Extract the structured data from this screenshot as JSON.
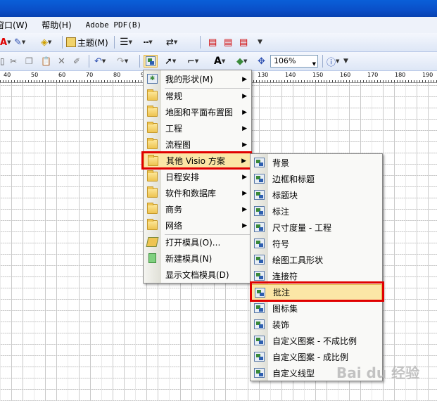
{
  "menubar": {
    "window": "窗口(W)",
    "help": "帮助(H)",
    "adobe": "Adobe PDF(B)"
  },
  "toolbar": {
    "theme_label": "主题(M)",
    "zoom": "106%"
  },
  "ruler": {
    "ticks": [
      "40",
      "50",
      "60",
      "70",
      "80",
      "90",
      "100",
      "110",
      "120",
      "130",
      "140",
      "150",
      "160",
      "170",
      "180",
      "190"
    ]
  },
  "shapes_menu": {
    "items": [
      {
        "label": "我的形状(M)",
        "icon": "special",
        "arrow": true
      },
      {
        "label": "常规",
        "icon": "folder",
        "arrow": true
      },
      {
        "label": "地图和平面布置图",
        "icon": "folder",
        "arrow": true
      },
      {
        "label": "工程",
        "icon": "folder",
        "arrow": true
      },
      {
        "label": "流程图",
        "icon": "folder",
        "arrow": true
      },
      {
        "label": "其他 Visio 方案",
        "icon": "folder",
        "arrow": true
      },
      {
        "label": "日程安排",
        "icon": "folder",
        "arrow": true
      },
      {
        "label": "软件和数据库",
        "icon": "folder",
        "arrow": true
      },
      {
        "label": "商务",
        "icon": "folder",
        "arrow": true
      },
      {
        "label": "网络",
        "icon": "folder",
        "arrow": true
      },
      {
        "label": "打开模具(O)...",
        "icon": "open",
        "arrow": false
      },
      {
        "label": "新建模具(N)",
        "icon": "new",
        "arrow": false
      },
      {
        "label": "显示文档模具(D)",
        "icon": "none",
        "arrow": false
      }
    ]
  },
  "submenu": {
    "items": [
      {
        "label": "背景"
      },
      {
        "label": "边框和标题"
      },
      {
        "label": "标题块"
      },
      {
        "label": "标注"
      },
      {
        "label": "尺寸度量 - 工程"
      },
      {
        "label": "符号"
      },
      {
        "label": "绘图工具形状"
      },
      {
        "label": "连接符"
      },
      {
        "label": "批注"
      },
      {
        "label": "图标集"
      },
      {
        "label": "装饰"
      },
      {
        "label": "自定义图案 - 不成比例"
      },
      {
        "label": "自定义图案 - 成比例"
      },
      {
        "label": "自定义线型"
      }
    ]
  },
  "watermark": "Bai du 经验",
  "colors": {
    "highlight": "#fbe6a6",
    "redbox": "#e00000"
  }
}
